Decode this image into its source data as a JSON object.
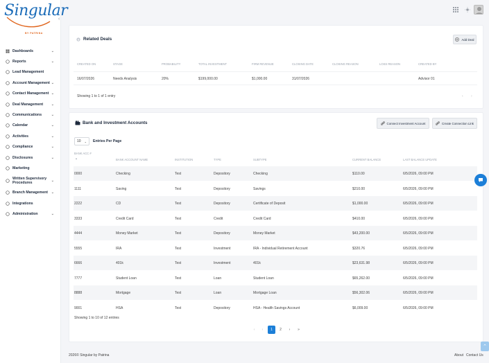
{
  "brand": {
    "name": "Singular",
    "tagline": "BY PATRINA"
  },
  "sidebar": {
    "items": [
      {
        "label": "Dashboards",
        "icon": "dashboard-icon",
        "chevron": true
      },
      {
        "label": "Reports",
        "icon": "reports-icon",
        "chevron": true
      },
      {
        "label": "Lead Management",
        "icon": "lead-icon",
        "chevron": false
      },
      {
        "label": "Account Management",
        "icon": "account-icon",
        "chevron": true
      },
      {
        "label": "Contact Management",
        "icon": "contact-icon",
        "chevron": true
      },
      {
        "label": "Deal Management",
        "icon": "deal-icon",
        "chevron": true
      },
      {
        "label": "Communications",
        "icon": "communications-icon",
        "chevron": true
      },
      {
        "label": "Calendar",
        "icon": "calendar-icon",
        "chevron": true
      },
      {
        "label": "Activities",
        "icon": "activities-icon",
        "chevron": true
      },
      {
        "label": "Compliance",
        "icon": "compliance-icon",
        "chevron": true
      },
      {
        "label": "Disclosures",
        "icon": "disclosures-icon",
        "chevron": true
      },
      {
        "label": "Marketing",
        "icon": "marketing-icon",
        "chevron": false
      },
      {
        "label": "Written Supervisory Procedures",
        "icon": "procedures-icon",
        "chevron": true
      },
      {
        "label": "Branch Management",
        "icon": "branch-icon",
        "chevron": true
      },
      {
        "label": "Integrations",
        "icon": "integrations-icon",
        "chevron": false
      },
      {
        "label": "Administration",
        "icon": "administration-icon",
        "chevron": true
      }
    ]
  },
  "deals": {
    "title": "Related Deals",
    "add_label": "Add Deal",
    "columns": [
      "CREATED ON",
      "STAGE",
      "PROBABILITY",
      "TOTAL INVESTMENT",
      "FIRM REVENUE",
      "CLOSING DATE",
      "CLOSING REASON",
      "LOSS REASON",
      "CREATED BY"
    ],
    "rows": [
      [
        "16/07/2026",
        "Needs Analysis",
        "20%",
        "$199,000.00",
        "$1,000.00",
        "31/07/2026",
        "",
        "",
        "Advisor 01"
      ]
    ],
    "footer": "Showing 1 to 1 of 1 entry"
  },
  "accounts": {
    "title": "Bank and Investment Accounts",
    "connect_label": "Connect Investment Account",
    "create_label": "Create Connection Link",
    "per_page_value": "10",
    "per_page_label": "Entries Per Page",
    "columns": [
      "BANK ACC #",
      "BANK ACCOUNT NAME",
      "INSTITUTION",
      "TYPE",
      "SUBTYPE",
      "CURRENT BALANCE",
      "LAST BALANCE UPDATE"
    ],
    "rows": [
      [
        "0000",
        "Checking",
        "Test",
        "Depository",
        "Checking",
        "$110.00",
        "6/5/2026, 09:00 PM"
      ],
      [
        "1111",
        "Saving",
        "Test",
        "Depository",
        "Savings",
        "$210.00",
        "6/5/2026, 09:00 PM"
      ],
      [
        "2222",
        "CD",
        "Test",
        "Depository",
        "Certificate of Deposit",
        "$1,000.00",
        "6/5/2026, 09:00 PM"
      ],
      [
        "3333",
        "Credit Card",
        "Test",
        "Credit",
        "Credit Card",
        "$410.00",
        "6/5/2026, 09:00 PM"
      ],
      [
        "4444",
        "Money Market",
        "Test",
        "Depository",
        "Money Market",
        "$43,200.00",
        "6/5/2026, 09:00 PM"
      ],
      [
        "5555",
        "IRA",
        "Test",
        "Investment",
        "IRA - Individual Retirement Account",
        "$320.76",
        "6/5/2026, 09:00 PM"
      ],
      [
        "6666",
        "401k",
        "Test",
        "Investment",
        "401k",
        "$23,631.98",
        "6/5/2026, 09:00 PM"
      ],
      [
        "7777",
        "Student Loan",
        "Test",
        "Loan",
        "Student Loan",
        "$65,262.00",
        "6/5/2026, 09:00 PM"
      ],
      [
        "8888",
        "Mortgage",
        "Test",
        "Loan",
        "Mortgage Loan",
        "$56,302.06",
        "6/5/2026, 09:00 PM"
      ],
      [
        "9001",
        "HSA",
        "Test",
        "Depository",
        "HSA - Health Savings Account",
        "$6,009.00",
        "6/5/2026, 09:00 PM"
      ]
    ],
    "footer": "Showing 1 to 10 of 12 entries",
    "pagination": [
      "‹",
      "‹",
      "1",
      "2",
      "›",
      "»"
    ]
  },
  "footer": {
    "copyright": "2026©",
    "brand": "Singular by Patrina",
    "about": "About",
    "contact": "Contact Us"
  },
  "colors": {
    "accent": "#1c7fd8",
    "logo_blue": "#1a6bb8",
    "logo_orange": "#e0651d"
  }
}
